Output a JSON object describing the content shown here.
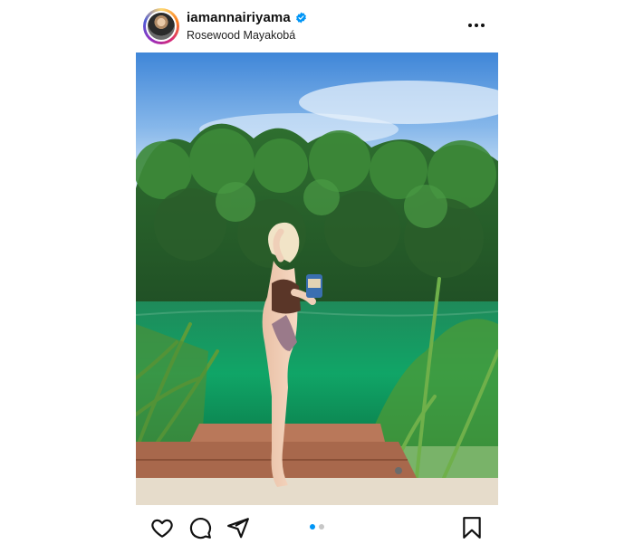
{
  "post": {
    "username": "iamannairiyama",
    "verified": true,
    "location": "Rosewood Mayakobá",
    "carousel": {
      "total": 2,
      "current": 1
    }
  },
  "icons": {
    "more": "more-horizontal-icon",
    "like": "heart-icon",
    "comment": "comment-icon",
    "share": "paper-plane-icon",
    "save": "bookmark-icon",
    "verified": "verified-badge-icon"
  },
  "colors": {
    "verified": "#0095f6",
    "active_dot": "#0095f6",
    "inactive_dot": "#c7c7c7"
  }
}
